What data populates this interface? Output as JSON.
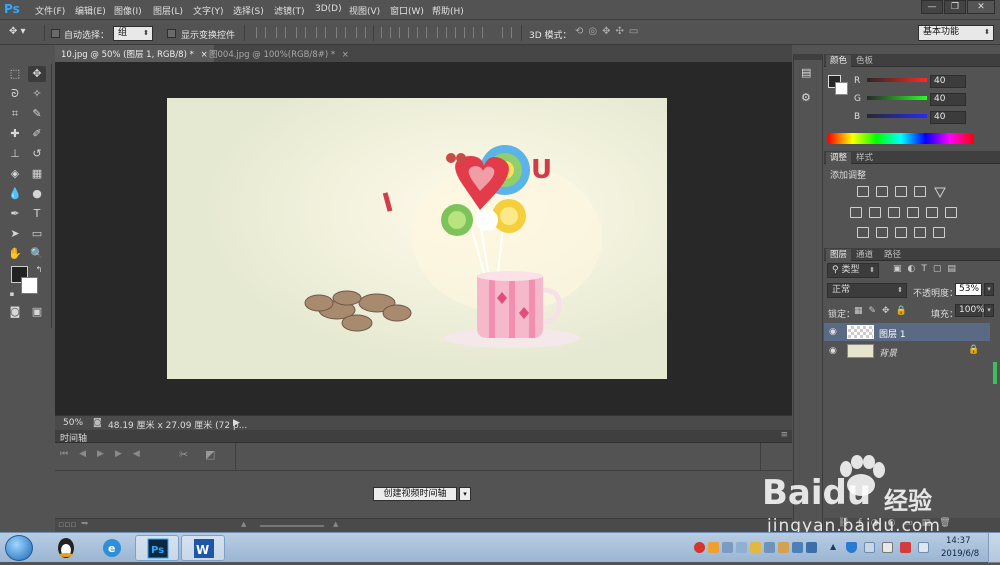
{
  "app": {
    "logo": "Ps"
  },
  "menu": [
    "文件(F)",
    "编辑(E)",
    "图像(I)",
    "图层(L)",
    "文字(Y)",
    "选择(S)",
    "滤镜(T)",
    "3D(D)",
    "视图(V)",
    "窗口(W)",
    "帮助(H)"
  ],
  "window_buttons": {
    "minimize": "—",
    "restore": "❐",
    "close": "✕"
  },
  "options": {
    "auto_select_label": "自动选择：",
    "auto_select_value": "组",
    "show_transform_label": "显示变换控件",
    "mode_3d_label": "3D 模式：",
    "workspace_value": "基本功能"
  },
  "tabs": [
    {
      "label": "10.jpg @ 50% (图层 1, RGB/8) *",
      "close": "×"
    },
    {
      "label": "图004.jpg @ 100%(RGB/8#) *",
      "close": "×"
    }
  ],
  "status": {
    "zoom": "50%",
    "doc_info": "48.19 厘米 x 27.09 厘米 (72 p..."
  },
  "timeline": {
    "title": "时间轴",
    "create_button": "创建视频时间轴"
  },
  "color_panel": {
    "tabs": [
      "颜色",
      "色板"
    ],
    "channels": [
      {
        "name": "R",
        "value": "40"
      },
      {
        "name": "G",
        "value": "40"
      },
      {
        "name": "B",
        "value": "40"
      }
    ],
    "swatch_color": "#282828"
  },
  "adjustments_panel": {
    "tabs": [
      "调整",
      "样式"
    ],
    "title": "添加调整"
  },
  "layers_panel": {
    "tabs": [
      "图层",
      "通道",
      "路径"
    ],
    "filter_label": "类型",
    "blend_mode": "正常",
    "opacity_label": "不透明度：",
    "opacity_value": "53%",
    "lock_label": "锁定：",
    "fill_label": "填充：",
    "fill_value": "100%",
    "layers": [
      {
        "name": "图层 1",
        "selected": true
      },
      {
        "name": "背景",
        "selected": false,
        "locked": true
      }
    ]
  },
  "watermark": {
    "brand": "Baidu",
    "sub": "经验",
    "url": "jingyan.baidu.com"
  },
  "taskbar": {
    "apps": [
      "start-orb",
      "qq-icon",
      "ie-icon",
      "photoshop-icon",
      "word-icon"
    ],
    "time": "14:37",
    "date": "2019/6/8"
  },
  "colors": {
    "accent": "#31a8ff",
    "panel": "#535353",
    "dark": "#282828",
    "selected_layer": "#5a6a85"
  }
}
